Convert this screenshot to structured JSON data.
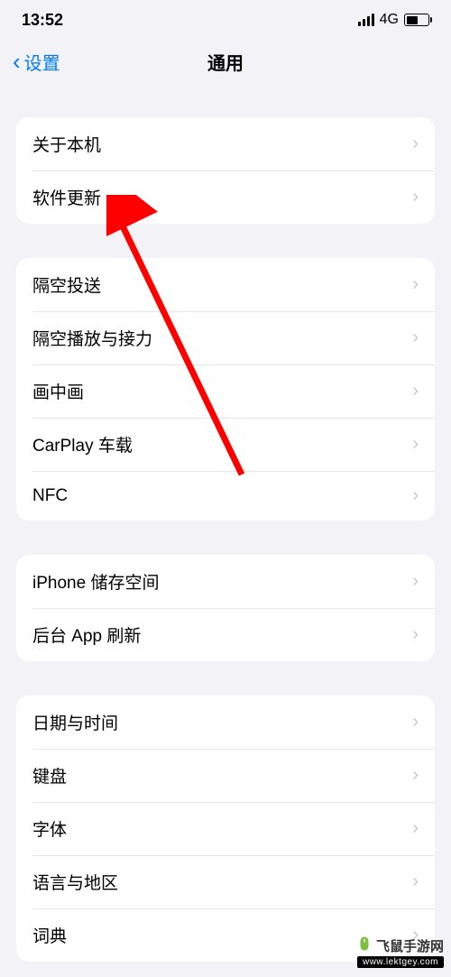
{
  "statusBar": {
    "time": "13:52",
    "network": "4G"
  },
  "nav": {
    "back": "设置",
    "title": "通用"
  },
  "group1": {
    "item0": "关于本机",
    "item1": "软件更新"
  },
  "group2": {
    "item0": "隔空投送",
    "item1": "隔空播放与接力",
    "item2": "画中画",
    "item3": "CarPlay 车载",
    "item4": "NFC"
  },
  "group3": {
    "item0": "iPhone 储存空间",
    "item1": "后台 App 刷新"
  },
  "group4": {
    "item0": "日期与时间",
    "item1": "键盘",
    "item2": "字体",
    "item3": "语言与地区",
    "item4": "词典"
  },
  "watermark": {
    "brand": "飞鼠手游网",
    "url": "www.lektgey.com"
  }
}
